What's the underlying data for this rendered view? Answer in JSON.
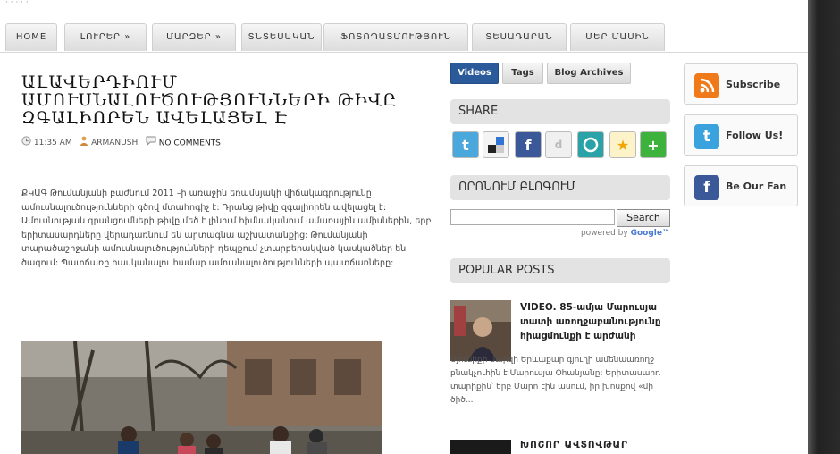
{
  "nav": {
    "items": [
      "HOME",
      "ԼՈՒՐԵՐ »",
      "ՄԱՐԶԵՐ »",
      "ՏՆՏԵՍԱԿԱՆ",
      "ՖՈՏՈՊԱՏՄՈՒԹՅՈՒՆ",
      "ՏԵՍԱԴԱՐԱՆ",
      "ՄԵՐ ՄԱՍԻՆ"
    ]
  },
  "article": {
    "title": "ԱԼԱՎԵՐԴԻՈՒՄ ԱՄՈՒՍՆԱԼՈՒԾՈՒԹՅՈՒՆՆԵՐԻ ԹԻՎԸ ԶԳԱԼԻՈՐԵՆ ԱՎԵԼԱՑԵԼ Է",
    "time": "11:35 AM",
    "author": "ARMANUSH",
    "comments": "NO COMMENTS",
    "body": "ՔԿԱԳ Թումանյանի բաժնում 2011 –ի առաջին եռամսյակի վիճակագրությունը ամուսնալուծությունների գծով մտահոգիչ է: Դրանց թիվը զգալիորեն ավելացել է: Ամուսնության գրանցումների թիվը մեծ է լինում հիմնականում ամառային ամիսներին, երբ երիտասարդները վերադառնում են արտագնա աշխատանքից: Թումանյանի տարածաշրջանի ամուսնալուծությունների դեպքում չտարբերակված կասկածներ են ծագում: Պատճառը հասկանալու համար ամուսնալուծությունների պատճառները:"
  },
  "sidebar": {
    "tabs": [
      "Videos",
      "Tags",
      "Blog Archives"
    ],
    "share_heading": "SHARE",
    "search_heading": "ՈՐՈՆՈՒՄ ԲԼՈԳՈՒՄ",
    "search_button": "Search",
    "powered_by": "powered by",
    "powered_brand": "Google™",
    "popular_heading": "POPULAR POSTS",
    "popular_post_1_title": "VIDEO. 85-ամյա Մարուսյա տատի առողջաբանությունը հիացմունքի է արժանի",
    "popular_post_1_excerpt": "Սյունիքի մարզի Երևաքար գյուղի ամենաառողջ բնակչուհին է Մարուսյա Օհանյանը: Երիտասարդ տարիքին՝ երբ Մարո էին ասում, իր խոսքով «մի ծիծ...",
    "popular_post_2_title": "ԽՈՇՈՐ ԱՎՏՈՎԹԱՐ"
  },
  "social": {
    "subscribe": "Subscribe",
    "follow": "Follow Us!",
    "fan": "Be Our Fan"
  },
  "colors": {
    "tab_active": "#2a5a9a",
    "rss": "#f07a1a",
    "twitter": "#3aa2dc",
    "facebook": "#3b5998"
  }
}
